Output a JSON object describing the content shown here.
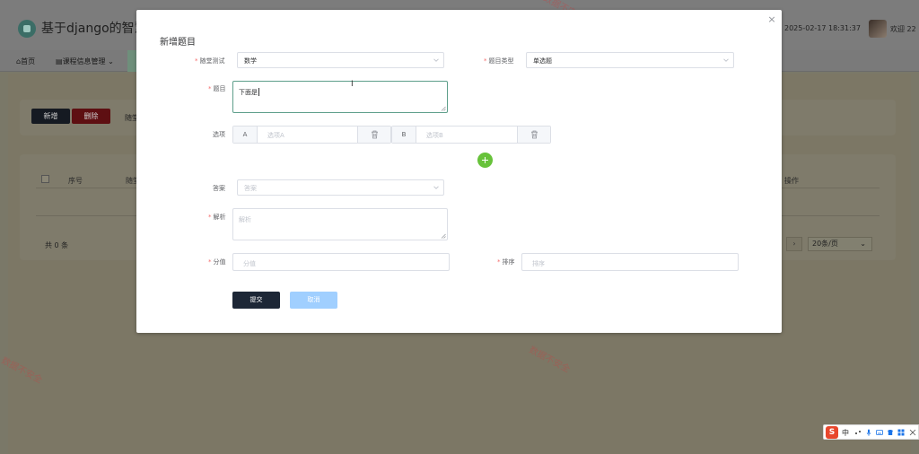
{
  "app": {
    "title": "基于django的智慧书",
    "datetime": "2025-02-17 18:31:37",
    "welcome": "欢迎 22",
    "nav": {
      "home": "首页",
      "course_menu": "课程信息管理"
    }
  },
  "background": {
    "add_label": "新增",
    "delete_label": "删除",
    "filter_text": "随堂",
    "table_headers": {
      "index": "序号",
      "col": "随堂",
      "ops": "操作"
    },
    "total": "共 0 条",
    "page_size": "20条/页",
    "watermark": "数据不安全"
  },
  "modal": {
    "title": "新增题目",
    "close": "×",
    "fields": {
      "quiz": {
        "label": "随堂测试",
        "value": "数学"
      },
      "type": {
        "label": "题目类型",
        "value": "单选题"
      },
      "question": {
        "label": "题目",
        "value": "下面是"
      },
      "options": {
        "label": "选项",
        "items": [
          {
            "letter": "A",
            "placeholder": "选项A"
          },
          {
            "letter": "B",
            "placeholder": "选项B"
          }
        ]
      },
      "answer": {
        "label": "答案",
        "placeholder": "答案"
      },
      "analysis": {
        "label": "解析",
        "placeholder": "解析"
      },
      "score": {
        "label": "分值",
        "placeholder": "分值"
      },
      "sort": {
        "label": "排序",
        "placeholder": "排序"
      }
    },
    "submit_label": "提交",
    "cancel_label": "取消"
  },
  "ime": {
    "logo": "S",
    "mode": "中"
  },
  "colors": {
    "primary_dark": "#1d2736",
    "cancel_blue": "#a0cfff",
    "required_red": "#f56c6c",
    "add_green": "#67c23a"
  }
}
